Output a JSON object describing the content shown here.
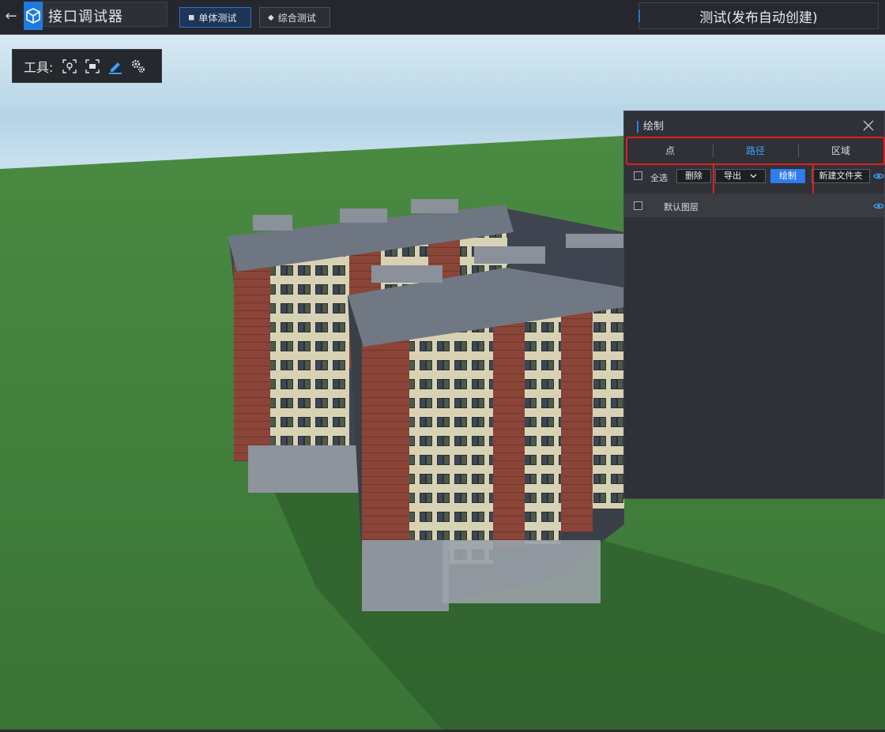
{
  "header": {
    "app_title": "接口调试器",
    "mode_buttons": [
      {
        "label": "单体测试",
        "active": true
      },
      {
        "label": "综合测试",
        "active": false
      }
    ],
    "scene_title": "测试(发布自动创建)"
  },
  "toolbar": {
    "label": "工具:",
    "tools": [
      "locate-pin-icon",
      "measure-frame-icon",
      "pen-draw-icon",
      "gears-settings-icon"
    ]
  },
  "draw_panel": {
    "title": "绘制",
    "tabs": [
      {
        "label": "点",
        "active": false
      },
      {
        "label": "路径",
        "active": true
      },
      {
        "label": "区域",
        "active": false
      }
    ],
    "select_all_label": "全选",
    "delete_label": "删除",
    "export_label": "导出",
    "draw_label": "绘制",
    "new_folder_label": "新建文件夹",
    "layers": [
      {
        "name": "默认图层",
        "checked": false,
        "visible": true
      }
    ]
  },
  "colors": {
    "accent_blue": "#2f7bf0",
    "highlight_red": "#e02020",
    "panel_bg": "#2f3136",
    "grass": "#3f7a3a"
  }
}
